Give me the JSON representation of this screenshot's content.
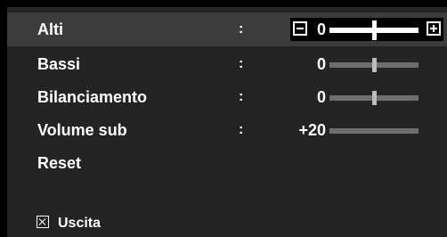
{
  "menu": {
    "items": [
      {
        "label": "Alti",
        "separator": ":",
        "value": "0",
        "level": 0.5,
        "selected": true
      },
      {
        "label": "Bassi",
        "separator": ":",
        "value": "0",
        "level": 0.5,
        "selected": false
      },
      {
        "label": "Bilanciamento",
        "separator": ":",
        "value": "0",
        "level": 0.5,
        "selected": false
      },
      {
        "label": "Volume sub",
        "separator": ":",
        "value": "+20",
        "level": 1.0,
        "selected": false
      },
      {
        "label": "Reset"
      }
    ]
  },
  "footer": {
    "exit_label": "Uscita",
    "exit_icon": "close-icon"
  },
  "colors": {
    "background": "#242424",
    "selected_row": "#3c3c3c",
    "text": "#ffffff",
    "slider_track": "#6e6e6e"
  }
}
